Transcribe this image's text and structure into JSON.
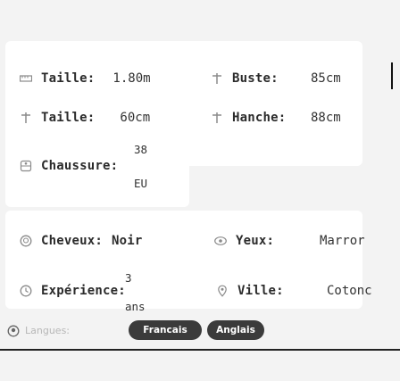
{
  "rows": {
    "r1": {
      "label1": "Taille:",
      "value1": "1.80m",
      "label2": "Buste:",
      "value2": "85cm"
    },
    "r2": {
      "label1": "Taille:",
      "value1": "60cm",
      "label2": "Hanche:",
      "value2": "88cm"
    },
    "r3": {
      "label": "Chaussure:",
      "value_top": "38",
      "value_bottom": "EU"
    },
    "r4": {
      "label1": "Cheveux:",
      "value1": "Noir",
      "label2": "Yeux:",
      "value2": "Marror"
    },
    "r5": {
      "label1": "Expérience:",
      "value_top": "3",
      "value_bottom": "ans",
      "label2": "Ville:",
      "value2": "Cotonc"
    }
  },
  "footer": {
    "langues_label": "Langues:",
    "languages": [
      "Francais",
      "Anglais"
    ]
  },
  "icons": {
    "height": "ruler-icon",
    "bust": "hanger-icon",
    "waist": "hanger-icon",
    "hip": "hanger-icon",
    "shoe": "shoe-icon",
    "hair": "face-icon",
    "eyes": "eye-icon",
    "experience": "clock-icon",
    "city": "location-pin-icon",
    "language": "globe-icon"
  },
  "colors": {
    "icon_gray": "#8a8a8a",
    "pill_bg": "#3b3b3b",
    "card_bg": "#ffffff",
    "page_bg": "#f3f3f3"
  }
}
